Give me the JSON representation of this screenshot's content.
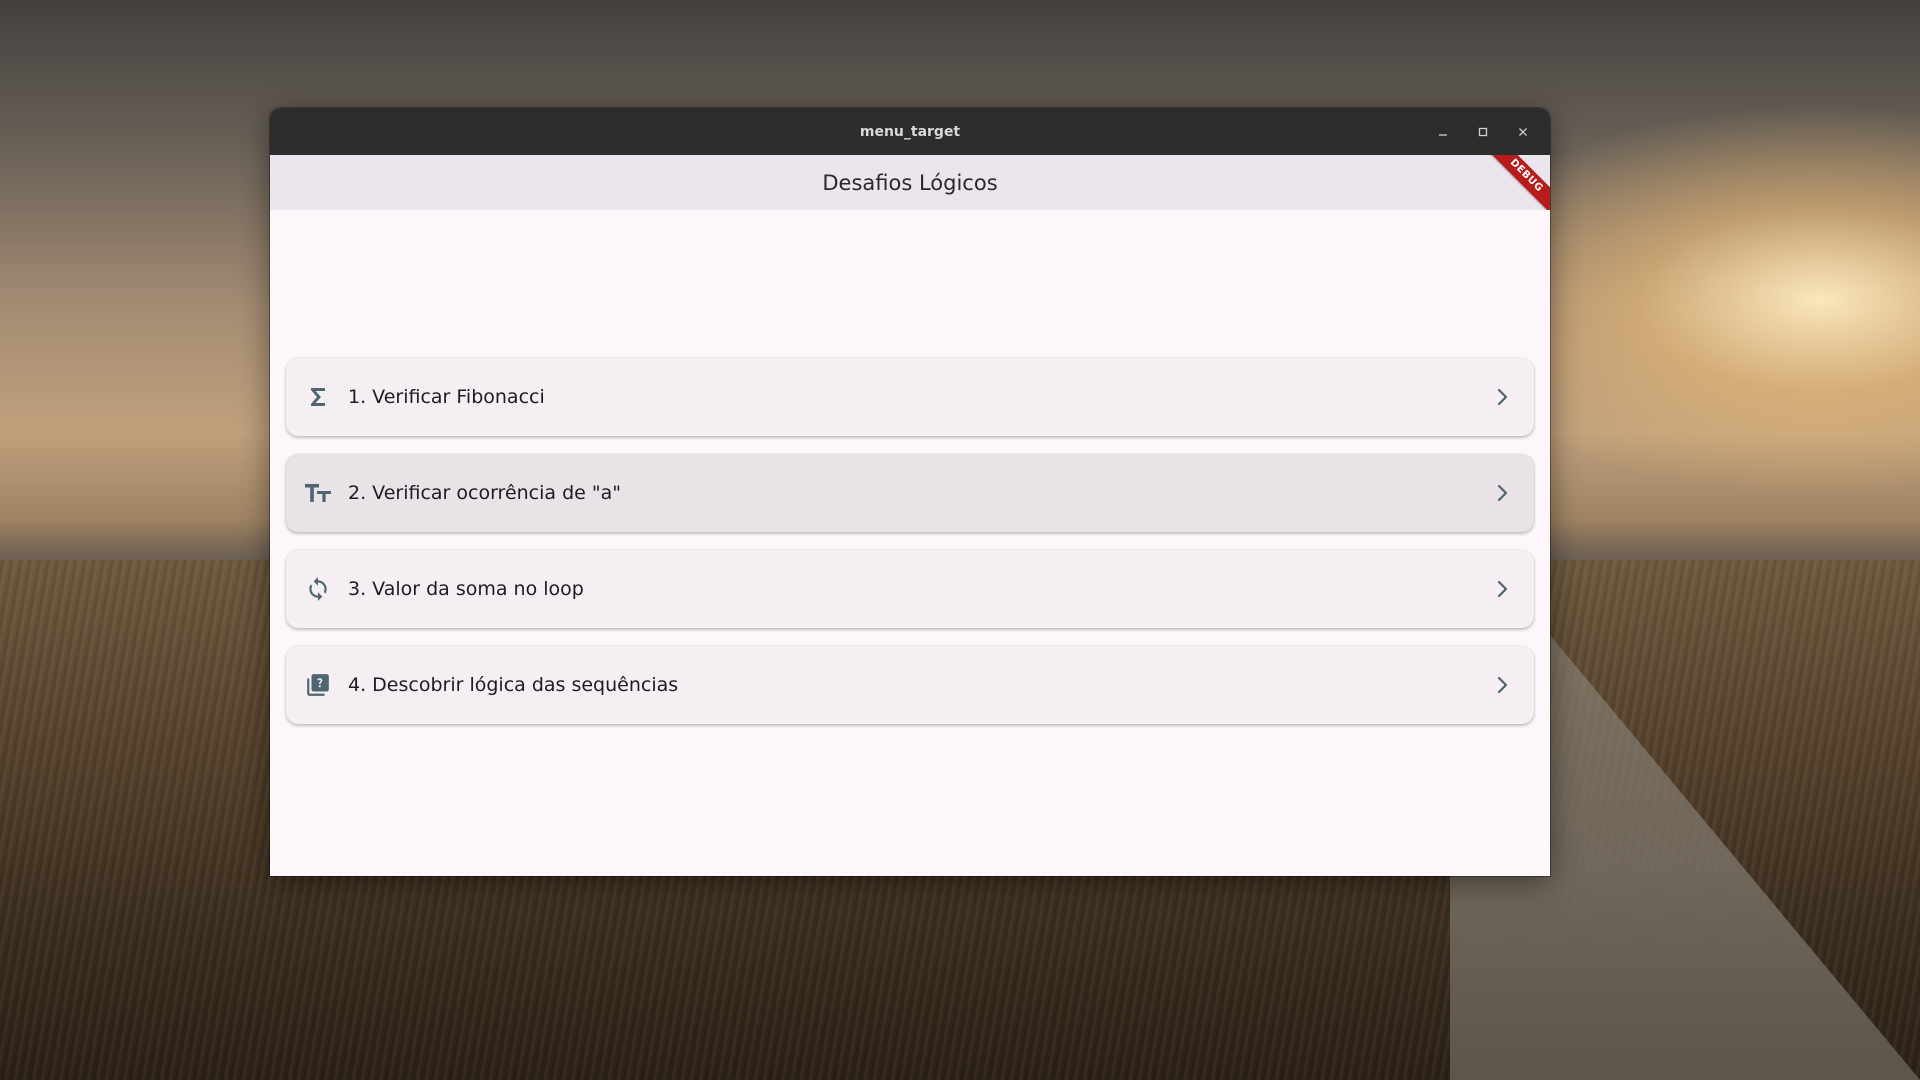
{
  "window": {
    "title": "menu_target"
  },
  "appbar": {
    "title": "Desafios Lógicos",
    "debug_banner": "DEBUG"
  },
  "menu": {
    "items": [
      {
        "label": "1. Verificar Fibonacci",
        "icon": "sigma-icon"
      },
      {
        "label": "2. Verificar ocorrência de \"a\"",
        "icon": "text-size-icon"
      },
      {
        "label": "3. Valor da soma no loop",
        "icon": "loop-icon"
      },
      {
        "label": "4. Descobrir lógica das sequências",
        "icon": "quiz-icon"
      }
    ]
  },
  "colors": {
    "icon": "#4e6671",
    "titlebar": "#2c2c2c",
    "appbar": "#ebe5ee",
    "window_bg": "#fdf7fb",
    "card_bg": "#f5eff4",
    "debug_banner": "#b71c1c"
  }
}
